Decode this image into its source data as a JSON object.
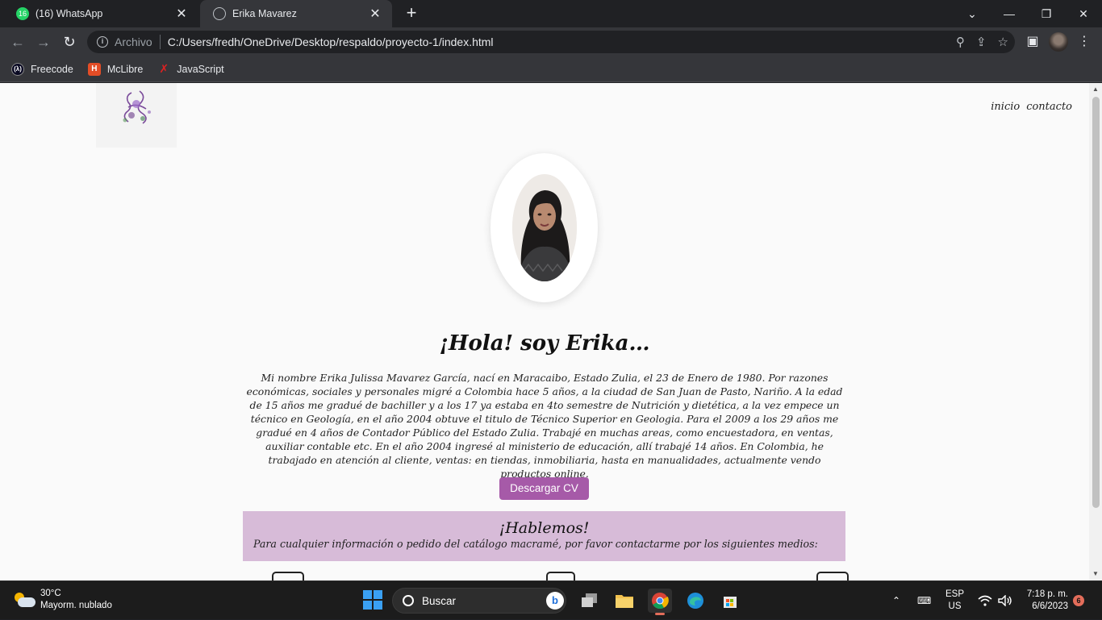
{
  "browser": {
    "tabs": [
      {
        "title": "(16) WhatsApp",
        "favicon": "whatsapp-icon",
        "favicon_text": "16",
        "active": false
      },
      {
        "title": "Erika Mavarez",
        "favicon": "globe-icon",
        "active": true
      }
    ],
    "omnibox": {
      "label": "Archivo",
      "url": "C:/Users/fredh/OneDrive/Desktop/respaldo/proyecto-1/index.html"
    },
    "bookmarks": [
      {
        "label": "Freecode",
        "icon": "freecodecamp-icon"
      },
      {
        "label": "McLibre",
        "icon": "html5-icon"
      },
      {
        "label": "JavaScript",
        "icon": "javascript-icon"
      }
    ]
  },
  "page": {
    "nav": {
      "home": "inicio",
      "contact": "contacto"
    },
    "heading": "¡Hola! soy Erika…",
    "bio": "Mi nombre Erika Julissa Mavarez García, nací en Maracaibo, Estado Zulia, el 23 de Enero de 1980. Por razones económicas, sociales y personales migré a Colombia hace 5 años, a la ciudad de San Juan de Pasto, Nariño. A la edad de 15 años me gradué de bachiller y a los 17 ya estaba en 4to semestre de Nutrición y dietética, a la vez empece un técnico en Geología, en el año 2004 obtuve el titulo de Técnico Superior en Geologia. Para el 2009 a los 29 años me gradué en 4 años de Contador Público del Estado Zulia. Trabajé en muchas areas, como encuestadora, en ventas, auxiliar contable etc. En el año 2004 ingresé al ministerio de educación, allí trabajé 14 años. En Colombia, he trabajado en atención al cliente, ventas: en tiendas, inmobiliaria, hasta en manualidades, actualmente vendo productos online.",
    "cv_button": "Descargar CV",
    "contact_title": "¡Hablemos!",
    "contact_text": "Para cualquier información o pedido del catálogo macramé, por favor contactarme por los siguientes medios:"
  },
  "taskbar": {
    "weather": {
      "temp": "30°C",
      "desc": "Mayorm. nublado"
    },
    "search_placeholder": "Buscar",
    "lang": {
      "code": "ESP",
      "region": "US"
    },
    "time": "7:18 p. m.",
    "date": "6/6/2023",
    "notifications": "6"
  },
  "colors": {
    "accent_button": "#a65aa8",
    "contact_bg": "#d7bbd8",
    "chrome_bg": "#202124",
    "toolbar_bg": "#35363a"
  }
}
